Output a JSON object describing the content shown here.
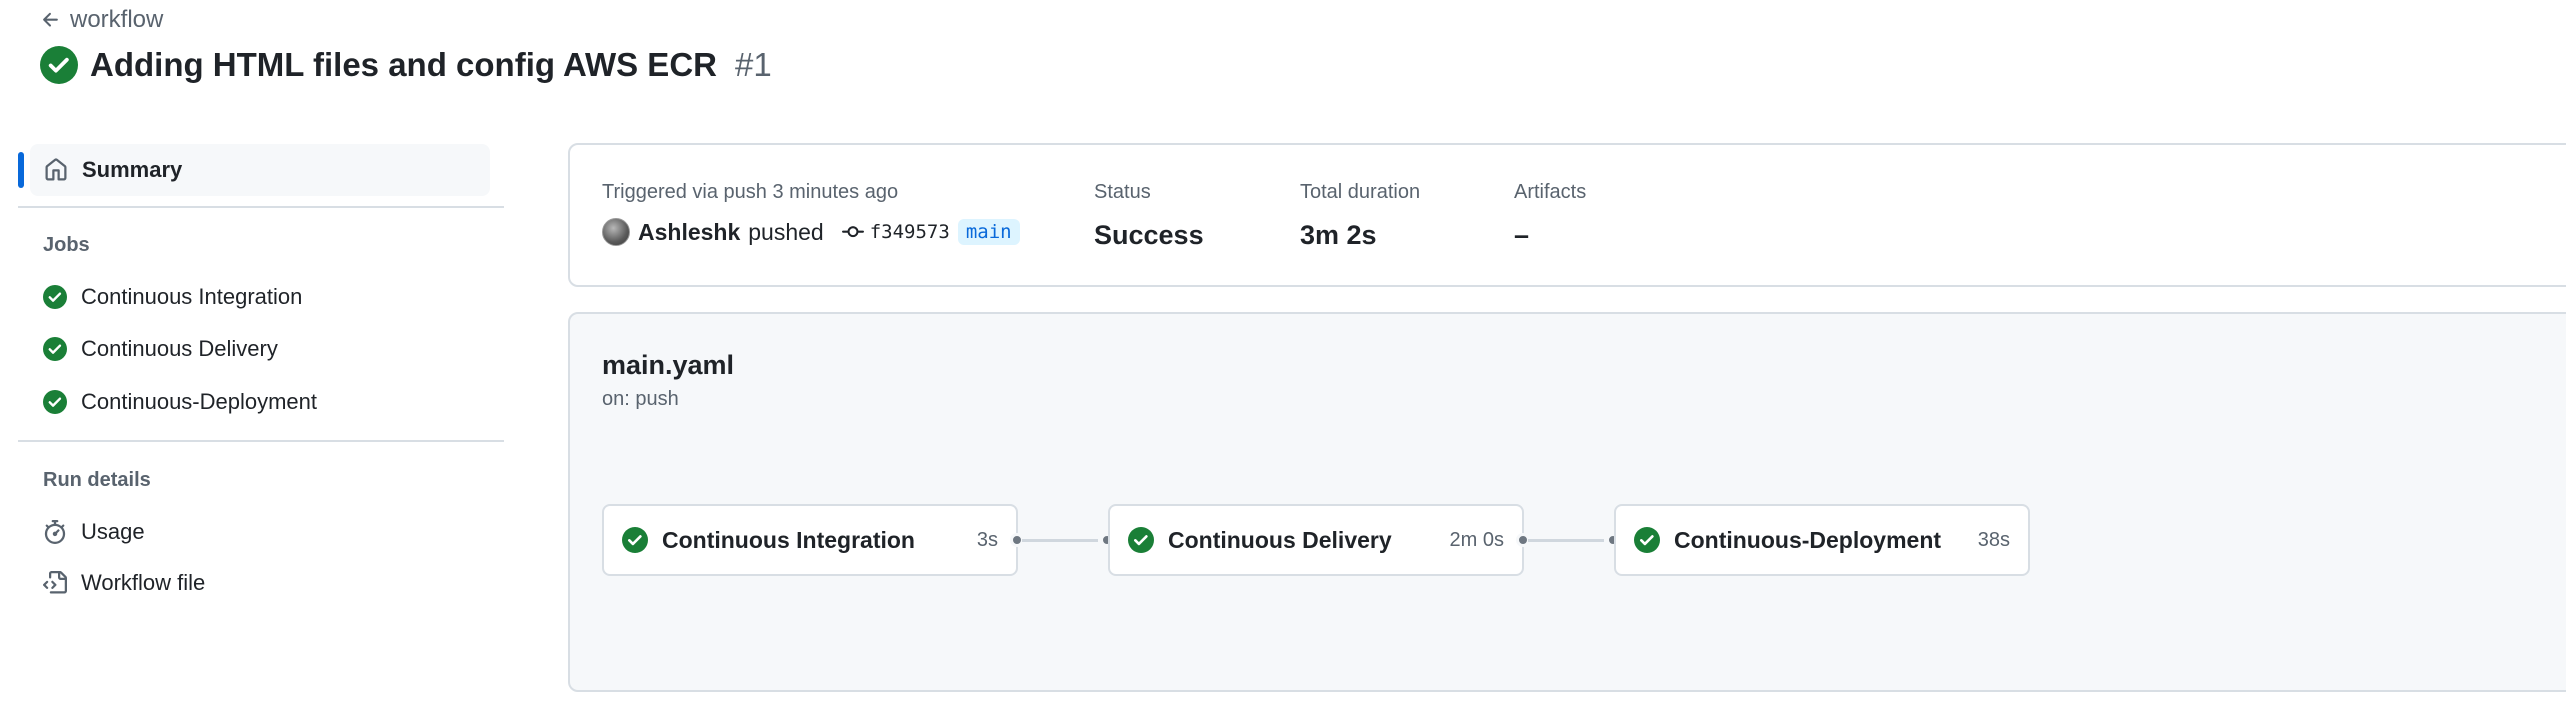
{
  "header": {
    "back_label": "workflow",
    "title": "Adding HTML files and config AWS ECR",
    "run_number": "#1"
  },
  "sidebar": {
    "summary_label": "Summary",
    "jobs_heading": "Jobs",
    "jobs": [
      {
        "label": "Continuous Integration",
        "status": "success"
      },
      {
        "label": "Continuous Delivery",
        "status": "success"
      },
      {
        "label": "Continuous-Deployment",
        "status": "success"
      }
    ],
    "run_details_heading": "Run details",
    "details": [
      {
        "label": "Usage",
        "icon": "stopwatch-icon"
      },
      {
        "label": "Workflow file",
        "icon": "file-code-icon"
      }
    ]
  },
  "run_info": {
    "trigger_text": "Triggered via push 3 minutes ago",
    "actor": "Ashleshk",
    "action": "pushed",
    "commit_sha": "f349573",
    "branch": "main",
    "status_label": "Status",
    "status_value": "Success",
    "duration_label": "Total duration",
    "duration_value": "3m 2s",
    "artifacts_label": "Artifacts",
    "artifacts_value": "–"
  },
  "workflow": {
    "file_name": "main.yaml",
    "trigger": "on: push",
    "jobs": [
      {
        "name": "Continuous Integration",
        "duration": "3s"
      },
      {
        "name": "Continuous Delivery",
        "duration": "2m 0s"
      },
      {
        "name": "Continuous-Deployment",
        "duration": "38s"
      }
    ]
  },
  "colors": {
    "success": "#1a7f37",
    "accent": "#0969da",
    "muted": "#59636e",
    "border": "#d8dee4"
  }
}
